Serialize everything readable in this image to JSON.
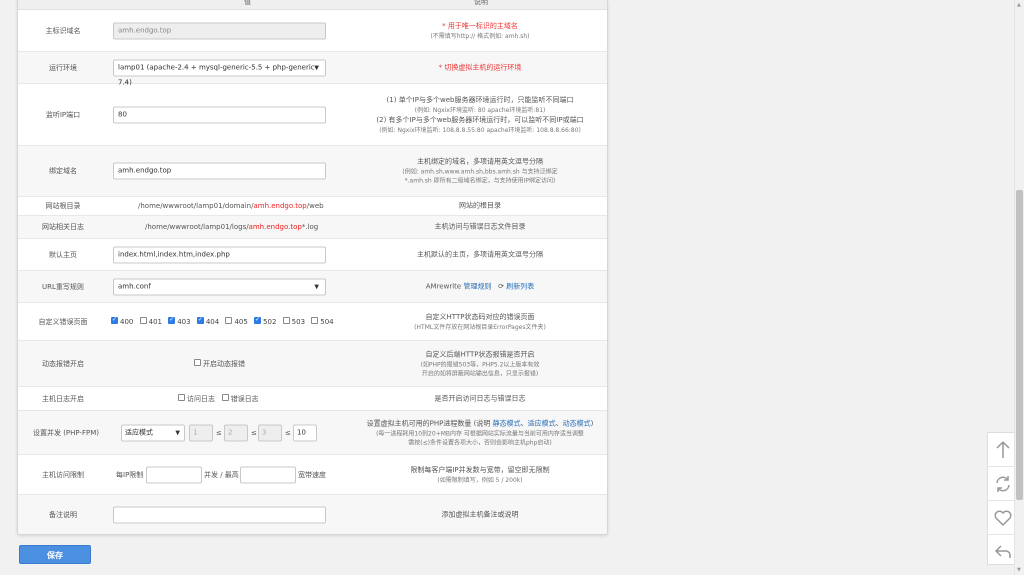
{
  "header": {
    "col_value": "值",
    "col_desc": "说明"
  },
  "rows": {
    "main_domain": {
      "label": "主标识域名",
      "value": "amh.endgo.top",
      "desc_req": "* 用于唯一标识的主域名",
      "desc_sub": "(不需填写http:// 格式例如: amh.sh)"
    },
    "runtime": {
      "label": "运行环境",
      "value": "lamp01 (apache-2.4 + mysql-generic-5.5 + php-generic-7.4)",
      "desc_req": "* 切换虚拟主机的运行环境"
    },
    "listen_ip": {
      "label": "监听IP端口",
      "value": "80",
      "desc_line1": "(1) 单个IP与多个web服务器环境运行时，只能监听不同端口",
      "desc_line2": "(例如: Ngxix环境监听: 80   apache环境监听:81)",
      "desc_line3": "(2) 有多个IP与多个web服务器环境运行时，可以监听不同IP或端口",
      "desc_line4": "(例如: Ngxix环境监听: 108.8.8.55:80   apache环境监听: 108.8.8.66:80)"
    },
    "bind_domain": {
      "label": "绑定域名",
      "value": "amh.endgo.top",
      "desc_line1": "主机绑定的域名，多项请用英文逗号分隔",
      "desc_line2": "(例如: amh.sh,www.amh.sh,bbs.amh.sh 与支持泛绑定",
      "desc_line3": "*.amh.sh 即所有二级域名绑定，与支持使用IP绑定访问)"
    },
    "web_root": {
      "label": "网站根目录",
      "prefix": "/home/wwwroot/lamp01/domain/",
      "domain": "amh.endgo.top",
      "suffix": "/web",
      "desc": "网站的根目录"
    },
    "log_dir": {
      "label": "网站相关日志",
      "prefix": "/home/wwwroot/lamp01/logs/",
      "domain": "amh.endgo.top",
      "suffix": "*.log",
      "desc": "主机访问与错误日志文件目录"
    },
    "default_page": {
      "label": "默认主页",
      "value": "index.html,index.htm,index.php",
      "desc": "主机默认的主页，多项请用英文逗号分隔"
    },
    "url_rewrite": {
      "label": "URL重写规则",
      "value": "amh.conf",
      "desc_prefix": "AMrewrite",
      "desc_link": "管理规则",
      "refresh_icon": "refresh-icon",
      "desc_refresh": "刷新列表"
    },
    "error_pages": {
      "label": "自定义错误页面",
      "items": [
        {
          "code": "400",
          "checked": true
        },
        {
          "code": "401",
          "checked": false
        },
        {
          "code": "403",
          "checked": true
        },
        {
          "code": "404",
          "checked": true
        },
        {
          "code": "405",
          "checked": false
        },
        {
          "code": "502",
          "checked": true
        },
        {
          "code": "503",
          "checked": false
        },
        {
          "code": "504",
          "checked": false
        }
      ],
      "desc_line1": "自定义HTTP状态码对应的错误页面",
      "desc_line2": "(HTML文件存放在网站根目录ErrorPages文件夹)"
    },
    "dynamic_error": {
      "label": "动态报错开启",
      "checkbox_label": "开启动态报错",
      "desc_line1": "自定义后端HTTP状态报错是否开启",
      "desc_line2": "(如PHP的报错503等，PHP5.2以上版本有效",
      "desc_line3": "开启的如将屏蔽网站输出信息，只显示报错)"
    },
    "host_log": {
      "label": "主机日志开启",
      "access_label": "访问日志",
      "error_label": "错误日志",
      "desc": "是否开启访问日志与错误日志"
    },
    "php_fpm": {
      "label": "设置并发 (PHP-FPM)",
      "mode": "适应模式",
      "v1": "1",
      "v2": "2",
      "v3": "3",
      "v4": "10",
      "le": "≤",
      "desc_prefix": "设置虚拟主机可用的PHP进程数量 (说明",
      "desc_link1": "静态模式",
      "desc_sep1": "、",
      "desc_link2": "适应模式",
      "desc_sep2": "、",
      "desc_link3": "动态模式",
      "desc_suffix": ")",
      "desc_line2": "(每一进程耗用10到20+MB内存 可根据网站实际流量与当前可用内存适当调整",
      "desc_line3": "需按(≤)条件设置各项大小，否则会影响主机php启动)"
    },
    "access_limit": {
      "label": "主机访问限制",
      "per_ip": "每IP限制",
      "concurrent": "并发 / 最高",
      "bandwidth": "宽带速度",
      "desc_line1": "限制每客户端IP并发数与宽带，留空即无限制",
      "desc_line2": "(如需限制填写，例如 5 / 200k)"
    },
    "remark": {
      "label": "备注说明",
      "value": "",
      "desc": "添加虚拟主机备注或说明"
    }
  },
  "save_label": "保存",
  "float_toolbar": [
    "back-to-top-icon",
    "refresh-icon",
    "heart-icon",
    "reply-icon"
  ]
}
